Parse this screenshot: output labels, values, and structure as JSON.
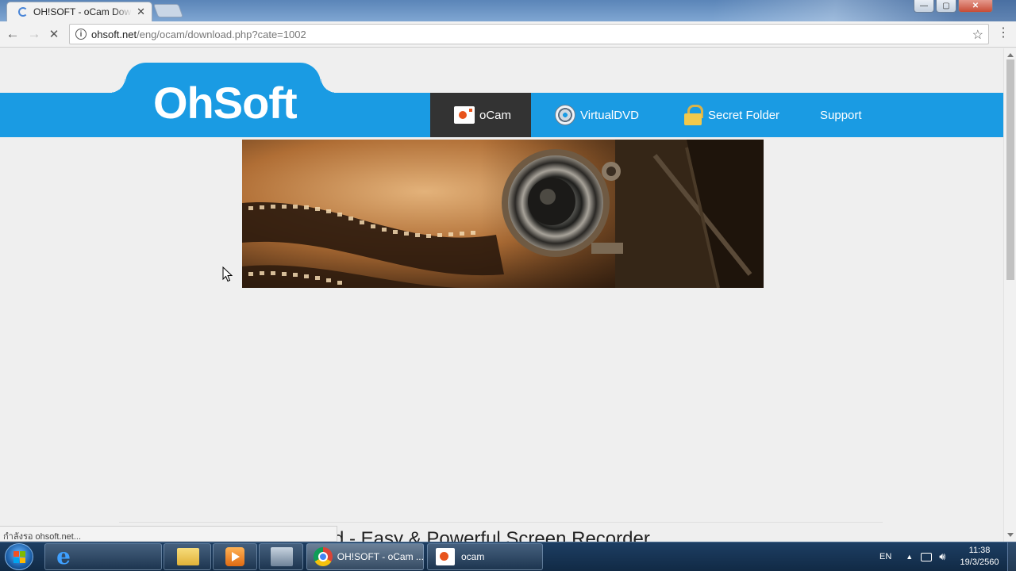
{
  "browser": {
    "tab_title": "OH!SOFT - oCam Download",
    "tab_close": "✕",
    "address_host": "ohsoft.net",
    "address_path": "/eng/ocam/download.php?cate=1002",
    "back": "←",
    "forward": "→",
    "stop": "✕",
    "info": "i",
    "star": "☆",
    "menu": "⋮",
    "win_min": "—",
    "win_max": "▢",
    "win_close": "✕"
  },
  "site": {
    "logo": "OhSoft",
    "nav": [
      {
        "label": "oCam",
        "icon": "ocam-icon",
        "active": true
      },
      {
        "label": "VirtualDVD",
        "icon": "dvd-icon"
      },
      {
        "label": "Secret Folder",
        "icon": "lock-icon"
      },
      {
        "label": "Support"
      }
    ],
    "headline_partial": "d - Easy & Powerful Screen Recorder"
  },
  "status_bar": "กำลังรอ ohsoft.net...",
  "taskbar": {
    "items": [
      {
        "label": "",
        "icon": "ie-icon"
      },
      {
        "label": "",
        "icon": "folder-icon"
      },
      {
        "label": "",
        "icon": "media-player-icon"
      },
      {
        "label": "",
        "icon": "computer-icon"
      },
      {
        "label": "OH!SOFT - oCam ...",
        "icon": "chrome-icon",
        "active": true
      },
      {
        "label": "ocam",
        "icon": "ocam-icon"
      }
    ],
    "language": "EN",
    "time": "11:38",
    "date": "19/3/2560"
  },
  "colors": {
    "brand_blue": "#1a9be3",
    "nav_active": "#333333"
  }
}
